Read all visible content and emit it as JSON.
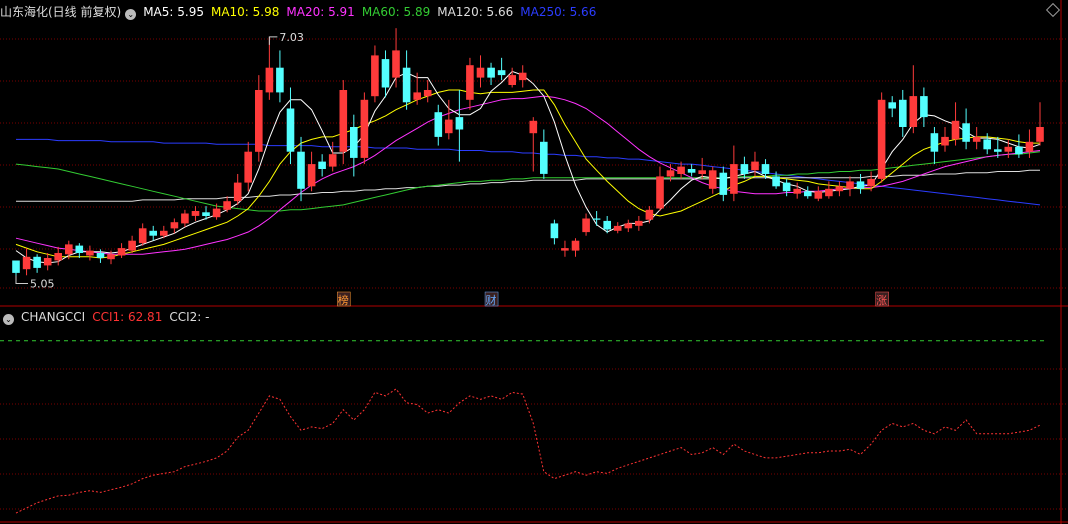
{
  "title": "山东海化(日线 前复权)",
  "ma_legend": [
    {
      "label": "MA5: 5.95",
      "color": "#ffffff"
    },
    {
      "label": "MA10: 5.98",
      "color": "#ffff00"
    },
    {
      "label": "MA20: 5.91",
      "color": "#ff33ff"
    },
    {
      "label": "MA60: 5.89",
      "color": "#33cc33"
    },
    {
      "label": "MA120: 5.66",
      "color": "#dddddd"
    },
    {
      "label": "MA250: 5.66",
      "color": "#2b3cff"
    }
  ],
  "indicator": {
    "name": "CHANGCCI",
    "cci1_label": "CCI1: 62.81",
    "cci2_label": "CCI2: -",
    "cci1_color": "#ff3333"
  },
  "colors": {
    "up": "#ff3b3b",
    "down": "#54ffff",
    "grid": "#7a0000",
    "ma5": "#ffffff",
    "ma10": "#ffff00",
    "ma20": "#ff33ff",
    "ma60": "#33cc33",
    "ma120": "#dddddd",
    "ma250": "#2b3cff",
    "dash_line": "#33cc33"
  },
  "chart_data": {
    "type": "candlestick",
    "ylim": [
      4.9,
      7.15
    ],
    "high_label": "7.03",
    "low_label": "5.05",
    "high_index": 24,
    "low_index": 0,
    "candles": [
      [
        5.22,
        5.12,
        5.18,
        5.05
      ],
      [
        5.15,
        5.25,
        5.32,
        5.1
      ],
      [
        5.25,
        5.16,
        5.27,
        5.12
      ],
      [
        5.18,
        5.24,
        5.28,
        5.14
      ],
      [
        5.22,
        5.28,
        5.33,
        5.18
      ],
      [
        5.27,
        5.35,
        5.38,
        5.23
      ],
      [
        5.34,
        5.28,
        5.36,
        5.24
      ],
      [
        5.26,
        5.3,
        5.34,
        5.22
      ],
      [
        5.28,
        5.24,
        5.31,
        5.2
      ],
      [
        5.23,
        5.27,
        5.3,
        5.19
      ],
      [
        5.26,
        5.32,
        5.36,
        5.24
      ],
      [
        5.3,
        5.38,
        5.42,
        5.28
      ],
      [
        5.36,
        5.48,
        5.52,
        5.34
      ],
      [
        5.46,
        5.42,
        5.5,
        5.38
      ],
      [
        5.42,
        5.46,
        5.5,
        5.4
      ],
      [
        5.48,
        5.53,
        5.56,
        5.44
      ],
      [
        5.52,
        5.6,
        5.63,
        5.49
      ],
      [
        5.58,
        5.62,
        5.66,
        5.54
      ],
      [
        5.61,
        5.58,
        5.66,
        5.55
      ],
      [
        5.57,
        5.64,
        5.68,
        5.55
      ],
      [
        5.63,
        5.7,
        5.74,
        5.61
      ],
      [
        5.7,
        5.85,
        5.92,
        5.67
      ],
      [
        5.85,
        6.1,
        6.18,
        5.78
      ],
      [
        6.1,
        6.6,
        6.72,
        6.02
      ],
      [
        6.58,
        6.78,
        7.03,
        6.52
      ],
      [
        6.78,
        6.58,
        6.92,
        6.5
      ],
      [
        6.45,
        6.1,
        6.62,
        6.0
      ],
      [
        6.1,
        5.8,
        6.22,
        5.7
      ],
      [
        5.82,
        6.0,
        6.1,
        5.78
      ],
      [
        6.02,
        5.96,
        6.08,
        5.9
      ],
      [
        5.98,
        6.08,
        6.18,
        5.94
      ],
      [
        6.1,
        6.6,
        6.68,
        6.0
      ],
      [
        6.3,
        6.05,
        6.4,
        5.9
      ],
      [
        6.05,
        6.52,
        6.58,
        6.0
      ],
      [
        6.55,
        6.88,
        6.96,
        6.5
      ],
      [
        6.85,
        6.62,
        6.92,
        6.54
      ],
      [
        6.7,
        6.92,
        7.1,
        6.62
      ],
      [
        6.78,
        6.5,
        6.92,
        6.44
      ],
      [
        6.52,
        6.58,
        6.74,
        6.48
      ],
      [
        6.55,
        6.6,
        6.68,
        6.5
      ],
      [
        6.42,
        6.22,
        6.48,
        6.15
      ],
      [
        6.25,
        6.36,
        6.52,
        6.2
      ],
      [
        6.38,
        6.28,
        6.6,
        6.02
      ],
      [
        6.52,
        6.8,
        6.86,
        6.44
      ],
      [
        6.7,
        6.78,
        6.88,
        6.62
      ],
      [
        6.78,
        6.7,
        6.82,
        6.64
      ],
      [
        6.76,
        6.72,
        6.86,
        6.68
      ],
      [
        6.64,
        6.72,
        6.78,
        6.62
      ],
      [
        6.68,
        6.74,
        6.8,
        6.62
      ],
      [
        6.25,
        6.35,
        6.38,
        5.94
      ],
      [
        6.18,
        5.92,
        6.28,
        5.88
      ],
      [
        5.52,
        5.4,
        5.55,
        5.35
      ],
      [
        5.3,
        5.32,
        5.38,
        5.25
      ],
      [
        5.3,
        5.38,
        5.4,
        5.25
      ],
      [
        5.45,
        5.56,
        5.6,
        5.42
      ],
      [
        5.56,
        5.55,
        5.62,
        5.5
      ],
      [
        5.54,
        5.47,
        5.58,
        5.44
      ],
      [
        5.46,
        5.5,
        5.53,
        5.44
      ],
      [
        5.48,
        5.52,
        5.55,
        5.45
      ],
      [
        5.5,
        5.54,
        5.58,
        5.46
      ],
      [
        5.55,
        5.63,
        5.66,
        5.52
      ],
      [
        5.64,
        5.9,
        5.98,
        5.62
      ],
      [
        5.9,
        5.95,
        6.0,
        5.86
      ],
      [
        5.92,
        5.98,
        6.02,
        5.88
      ],
      [
        5.96,
        5.93,
        6.0,
        5.9
      ],
      [
        5.92,
        5.95,
        6.05,
        5.88
      ],
      [
        5.8,
        5.95,
        5.98,
        5.76
      ],
      [
        5.93,
        5.75,
        5.98,
        5.7
      ],
      [
        5.76,
        6.0,
        6.15,
        5.7
      ],
      [
        6.0,
        5.92,
        6.06,
        5.88
      ],
      [
        5.95,
        6.02,
        6.1,
        5.9
      ],
      [
        6.0,
        5.92,
        6.04,
        5.88
      ],
      [
        5.9,
        5.82,
        5.94,
        5.8
      ],
      [
        5.85,
        5.78,
        5.88,
        5.74
      ],
      [
        5.76,
        5.8,
        5.85,
        5.72
      ],
      [
        5.78,
        5.74,
        5.82,
        5.72
      ],
      [
        5.72,
        5.78,
        5.82,
        5.7
      ],
      [
        5.74,
        5.8,
        5.86,
        5.72
      ],
      [
        5.78,
        5.82,
        5.86,
        5.74
      ],
      [
        5.8,
        5.86,
        5.9,
        5.74
      ],
      [
        5.86,
        5.8,
        5.92,
        5.76
      ],
      [
        5.82,
        5.88,
        5.94,
        5.78
      ],
      [
        5.88,
        6.52,
        6.58,
        5.85
      ],
      [
        6.5,
        6.45,
        6.55,
        6.38
      ],
      [
        6.52,
        6.3,
        6.6,
        6.22
      ],
      [
        6.3,
        6.55,
        6.8,
        6.25
      ],
      [
        6.55,
        6.38,
        6.62,
        6.3
      ],
      [
        6.25,
        6.1,
        6.3,
        6.0
      ],
      [
        6.15,
        6.22,
        6.3,
        6.1
      ],
      [
        6.2,
        6.35,
        6.5,
        6.15
      ],
      [
        6.33,
        6.18,
        6.45,
        6.12
      ],
      [
        6.18,
        6.22,
        6.3,
        6.12
      ],
      [
        6.2,
        6.12,
        6.25,
        6.08
      ],
      [
        6.12,
        6.1,
        6.22,
        6.05
      ],
      [
        6.1,
        6.14,
        6.2,
        6.05
      ],
      [
        6.14,
        6.08,
        6.24,
        6.05
      ],
      [
        6.1,
        6.18,
        6.28,
        6.05
      ],
      [
        6.18,
        6.3,
        6.5,
        6.15
      ]
    ],
    "ma5": [
      5.3,
      5.24,
      5.21,
      5.2,
      5.21,
      5.26,
      5.29,
      5.29,
      5.29,
      5.28,
      5.29,
      5.32,
      5.35,
      5.38,
      5.41,
      5.44,
      5.49,
      5.53,
      5.56,
      5.59,
      5.63,
      5.68,
      5.76,
      5.96,
      6.21,
      6.42,
      6.52,
      6.52,
      6.44,
      6.27,
      6.09,
      6.09,
      6.14,
      6.24,
      6.43,
      6.55,
      6.7,
      6.74,
      6.7,
      6.7,
      6.56,
      6.45,
      6.4,
      6.4,
      6.45,
      6.59,
      6.66,
      6.75,
      6.72,
      6.65,
      6.55,
      6.34,
      6.07,
      5.83,
      5.65,
      5.51,
      5.45,
      5.49,
      5.52,
      5.52,
      5.54,
      5.63,
      5.71,
      5.8,
      5.87,
      5.9,
      5.89,
      5.88,
      5.9,
      5.92,
      5.94,
      5.9,
      5.87,
      5.84,
      5.82,
      5.78,
      5.77,
      5.78,
      5.79,
      5.8,
      5.82,
      5.83,
      5.96,
      6.1,
      6.2,
      6.33,
      6.4,
      6.39,
      6.35,
      6.32,
      6.26,
      6.21,
      6.21,
      6.2,
      6.17,
      6.14,
      6.13,
      6.16
    ],
    "ma10": [
      5.35,
      5.32,
      5.29,
      5.27,
      5.25,
      5.25,
      5.25,
      5.25,
      5.24,
      5.25,
      5.27,
      5.29,
      5.31,
      5.33,
      5.35,
      5.38,
      5.41,
      5.44,
      5.47,
      5.5,
      5.53,
      5.58,
      5.64,
      5.74,
      5.86,
      6.0,
      6.1,
      6.17,
      6.2,
      6.22,
      6.22,
      6.25,
      6.28,
      6.32,
      6.35,
      6.39,
      6.44,
      6.48,
      6.52,
      6.55,
      6.58,
      6.6,
      6.6,
      6.58,
      6.57,
      6.58,
      6.58,
      6.58,
      6.59,
      6.6,
      6.6,
      6.48,
      6.32,
      6.18,
      6.04,
      5.95,
      5.86,
      5.78,
      5.7,
      5.64,
      5.6,
      5.58,
      5.6,
      5.62,
      5.66,
      5.7,
      5.74,
      5.78,
      5.83,
      5.86,
      5.9,
      5.9,
      5.89,
      5.88,
      5.87,
      5.86,
      5.84,
      5.83,
      5.82,
      5.81,
      5.8,
      5.8,
      5.86,
      5.93,
      6.0,
      6.07,
      6.12,
      6.15,
      6.18,
      6.2,
      6.21,
      6.22,
      6.22,
      6.21,
      6.2,
      6.18,
      6.17,
      6.17
    ],
    "ma20": [
      5.4,
      5.38,
      5.36,
      5.34,
      5.32,
      5.31,
      5.3,
      5.29,
      5.28,
      5.27,
      5.27,
      5.27,
      5.27,
      5.28,
      5.29,
      5.3,
      5.31,
      5.33,
      5.35,
      5.37,
      5.39,
      5.42,
      5.45,
      5.5,
      5.56,
      5.63,
      5.7,
      5.77,
      5.83,
      5.88,
      5.92,
      5.95,
      5.98,
      6.02,
      6.07,
      6.13,
      6.19,
      6.24,
      6.29,
      6.34,
      6.38,
      6.41,
      6.44,
      6.46,
      6.48,
      6.5,
      6.52,
      6.53,
      6.53,
      6.54,
      6.55,
      6.54,
      6.52,
      6.49,
      6.45,
      6.39,
      6.33,
      6.26,
      6.19,
      6.12,
      6.06,
      6.01,
      5.97,
      5.93,
      5.89,
      5.85,
      5.82,
      5.8,
      5.78,
      5.77,
      5.76,
      5.76,
      5.76,
      5.77,
      5.77,
      5.78,
      5.78,
      5.79,
      5.8,
      5.8,
      5.81,
      5.81,
      5.82,
      5.84,
      5.86,
      5.89,
      5.92,
      5.95,
      5.98,
      6.0,
      6.02,
      6.04,
      6.06,
      6.07,
      6.08,
      6.09,
      6.1,
      6.11
    ],
    "ma60": [
      6.0,
      5.99,
      5.98,
      5.97,
      5.96,
      5.94,
      5.92,
      5.9,
      5.88,
      5.86,
      5.84,
      5.82,
      5.8,
      5.78,
      5.76,
      5.74,
      5.72,
      5.7,
      5.68,
      5.66,
      5.65,
      5.64,
      5.63,
      5.62,
      5.62,
      5.62,
      5.63,
      5.63,
      5.64,
      5.65,
      5.66,
      5.67,
      5.69,
      5.71,
      5.73,
      5.75,
      5.77,
      5.79,
      5.81,
      5.82,
      5.83,
      5.84,
      5.85,
      5.86,
      5.86,
      5.87,
      5.87,
      5.88,
      5.88,
      5.89,
      5.89,
      5.89,
      5.89,
      5.89,
      5.89,
      5.89,
      5.89,
      5.89,
      5.89,
      5.89,
      5.89,
      5.89,
      5.89,
      5.89,
      5.89,
      5.89,
      5.89,
      5.89,
      5.89,
      5.9,
      5.9,
      5.9,
      5.91,
      5.91,
      5.92,
      5.92,
      5.93,
      5.93,
      5.94,
      5.94,
      5.95,
      5.95,
      5.96,
      5.97,
      5.98,
      5.99,
      6.0,
      6.01,
      6.02,
      6.03,
      6.04,
      6.05,
      6.06,
      6.07,
      6.08,
      6.08,
      6.09,
      6.1
    ],
    "ma120": [
      5.7,
      5.7,
      5.7,
      5.7,
      5.7,
      5.7,
      5.7,
      5.7,
      5.7,
      5.7,
      5.7,
      5.7,
      5.71,
      5.71,
      5.71,
      5.71,
      5.72,
      5.72,
      5.72,
      5.72,
      5.73,
      5.73,
      5.73,
      5.74,
      5.74,
      5.75,
      5.75,
      5.76,
      5.76,
      5.77,
      5.77,
      5.78,
      5.78,
      5.79,
      5.79,
      5.8,
      5.8,
      5.81,
      5.81,
      5.82,
      5.82,
      5.83,
      5.83,
      5.84,
      5.84,
      5.85,
      5.85,
      5.86,
      5.86,
      5.87,
      5.87,
      5.87,
      5.87,
      5.87,
      5.88,
      5.88,
      5.88,
      5.88,
      5.88,
      5.88,
      5.88,
      5.88,
      5.88,
      5.88,
      5.88,
      5.88,
      5.88,
      5.89,
      5.89,
      5.89,
      5.89,
      5.89,
      5.89,
      5.89,
      5.89,
      5.89,
      5.89,
      5.89,
      5.89,
      5.89,
      5.89,
      5.9,
      5.9,
      5.9,
      5.91,
      5.91,
      5.91,
      5.92,
      5.92,
      5.92,
      5.93,
      5.93,
      5.93,
      5.94,
      5.94,
      5.94,
      5.95,
      5.95
    ],
    "ma250": [
      6.2,
      6.2,
      6.2,
      6.2,
      6.19,
      6.19,
      6.19,
      6.19,
      6.19,
      6.18,
      6.18,
      6.18,
      6.18,
      6.18,
      6.17,
      6.17,
      6.17,
      6.17,
      6.17,
      6.16,
      6.16,
      6.16,
      6.16,
      6.16,
      6.15,
      6.15,
      6.15,
      6.15,
      6.15,
      6.14,
      6.14,
      6.14,
      6.14,
      6.14,
      6.13,
      6.13,
      6.13,
      6.13,
      6.12,
      6.12,
      6.12,
      6.12,
      6.11,
      6.11,
      6.11,
      6.1,
      6.1,
      6.1,
      6.09,
      6.09,
      6.08,
      6.08,
      6.07,
      6.07,
      6.06,
      6.06,
      6.05,
      6.05,
      6.04,
      6.04,
      6.03,
      6.02,
      6.01,
      6.0,
      6.0,
      5.99,
      5.98,
      5.97,
      5.96,
      5.95,
      5.94,
      5.93,
      5.92,
      5.91,
      5.9,
      5.89,
      5.88,
      5.87,
      5.86,
      5.85,
      5.84,
      5.83,
      5.82,
      5.81,
      5.8,
      5.79,
      5.78,
      5.77,
      5.76,
      5.75,
      5.74,
      5.73,
      5.72,
      5.71,
      5.7,
      5.69,
      5.68,
      5.67
    ],
    "markers": [
      {
        "index": 31,
        "label": "榜",
        "color": "#ff9933"
      },
      {
        "index": 45,
        "label": "财",
        "color": "#66aaff"
      },
      {
        "index": 82,
        "label": "涨",
        "color": "#ff5555"
      }
    ],
    "cci": {
      "ylim": [
        -320,
        260
      ],
      "dash_level": 200,
      "values": [
        -300,
        -285,
        -270,
        -260,
        -250,
        -248,
        -240,
        -235,
        -240,
        -232,
        -225,
        -215,
        -200,
        -190,
        -185,
        -180,
        -165,
        -158,
        -150,
        -140,
        -120,
        -80,
        -60,
        -10,
        40,
        30,
        -20,
        -60,
        -50,
        -55,
        -40,
        0,
        -30,
        0,
        50,
        40,
        60,
        20,
        15,
        -10,
        0,
        -10,
        20,
        40,
        30,
        40,
        30,
        50,
        45,
        -40,
        -180,
        -200,
        -190,
        -180,
        -190,
        -180,
        -185,
        -170,
        -160,
        -150,
        -140,
        -130,
        -120,
        -110,
        -130,
        -125,
        -110,
        -130,
        -100,
        -120,
        -130,
        -140,
        -140,
        -135,
        -130,
        -125,
        -125,
        -120,
        -120,
        -115,
        -130,
        -100,
        -60,
        -40,
        -50,
        -40,
        -60,
        -70,
        -50,
        -60,
        -30,
        -70,
        -70,
        -70,
        -70,
        -65,
        -60,
        -45
      ]
    }
  }
}
